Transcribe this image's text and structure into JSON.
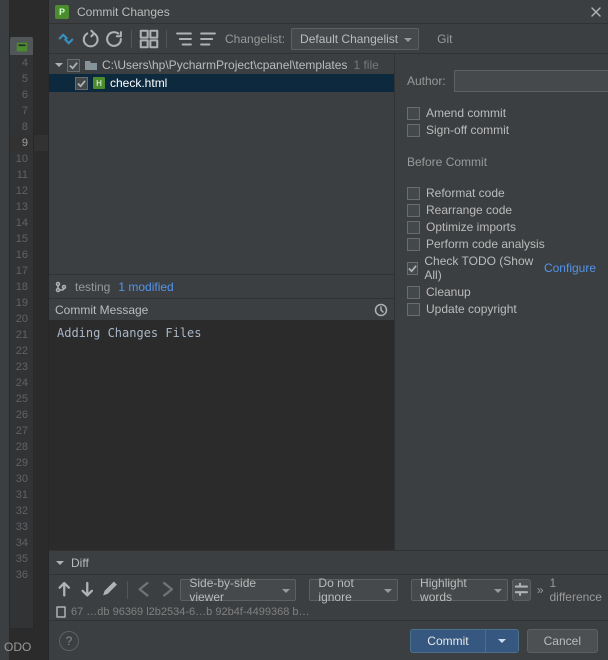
{
  "titlebar": {
    "title": "Commit Changes"
  },
  "toolbar": {
    "changelist_label": "Changelist:",
    "changelist_value": "Default Changelist",
    "vcs_label": "Git"
  },
  "tree": {
    "root_path": "C:\\Users\\hp\\PycharmProject\\cpanel\\templates",
    "root_suffix": "1 file",
    "file_name": "check.html"
  },
  "branch": {
    "name": "testing",
    "modified": "1 modified"
  },
  "commit_msg": {
    "header": "Commit Message",
    "text": "Adding Changes Files"
  },
  "right": {
    "author_label": "Author:",
    "author_value": "",
    "amend": "Amend commit",
    "signoff": "Sign-off commit",
    "before_title": "Before Commit",
    "reformat": "Reformat code",
    "rearrange": "Rearrange code",
    "optimize": "Optimize imports",
    "analysis": "Perform code analysis",
    "todo": "Check TODO (Show All)",
    "configure": "Configure",
    "cleanup": "Cleanup",
    "copyright": "Update copyright"
  },
  "diff": {
    "title": "Diff",
    "viewer": "Side-by-side viewer",
    "ignore": "Do not ignore",
    "highlight": "Highlight words",
    "count": "1 difference",
    "path": "67 …db 96369 l2b2534-6…b 92b4f-4499368 b…"
  },
  "footer": {
    "commit": "Commit",
    "cancel": "Cancel"
  },
  "gutter": {
    "start": 4,
    "end": 36,
    "current": 9
  },
  "sidebar_label": "ODO"
}
